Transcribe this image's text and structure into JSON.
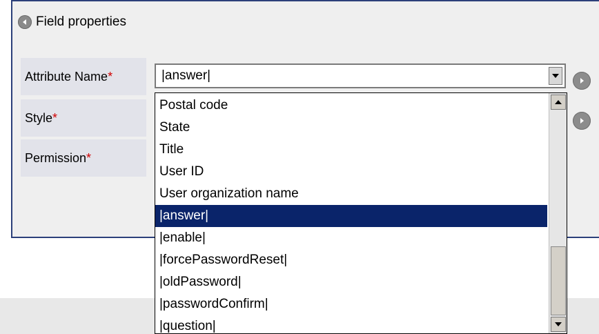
{
  "panel": {
    "title": "Field properties"
  },
  "fields": [
    {
      "label": "Attribute Name",
      "required_mark": "*"
    },
    {
      "label": "Style",
      "required_mark": "*"
    },
    {
      "label": "Permission",
      "required_mark": "*"
    }
  ],
  "attribute_select": {
    "value": "|answer|",
    "options": [
      "Postal code",
      "State",
      "Title",
      "User ID",
      "User organization name",
      "|answer|",
      "|enable|",
      "|forcePasswordReset|",
      "|oldPassword|",
      "|passwordConfirm|",
      "|question|"
    ],
    "selected_option": "|answer|"
  },
  "colors": {
    "panel_border": "#2b3f7a",
    "selection_bg": "#0a246a",
    "required": "#d00000",
    "label_bg": "#e2e3ea"
  },
  "icons": {
    "header": "back-arrow-icon",
    "row_next": "next-arrow-icon"
  }
}
